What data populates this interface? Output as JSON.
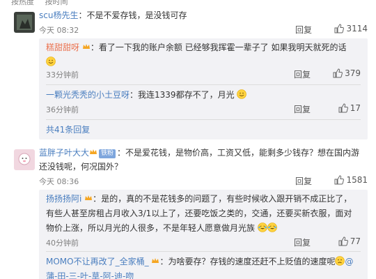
{
  "top_strip": {
    "left": "按热度",
    "right": "按时间"
  },
  "comments": [
    {
      "user": "scu杨先生",
      "text": "不是不爱存钱，是没钱可存",
      "time": "今天 08:32",
      "reply_label": "回复",
      "likes": "3114",
      "replies": [
        {
          "user": "糕甜甜呀",
          "text": "看了一下我的账户余额  已经够我挥霍一辈子了  如果我明天就死的话",
          "time": "33分钟前",
          "reply_label": "回复",
          "likes": "379"
        },
        {
          "user": "一颗光秃秃的小土豆呀",
          "text": "我连1339都存不了，月光",
          "time": "36分钟前",
          "reply_label": "回复",
          "likes": "17"
        }
      ],
      "more_replies": "共41条回复"
    },
    {
      "user": "蓝胖子叶大大",
      "badge": "铁粉",
      "text_line1": "不是爱花钱，是物价高，工资又低，能剩多少钱存？想在国内游",
      "text_line2": "还没钱呢，何况国外？",
      "time": "今天 08:36",
      "reply_label": "回复",
      "likes": "1581",
      "replies": [
        {
          "user": "扬扬扬阿i",
          "line1": "是的，真的不是花钱多的问题了，有些时候收入跟开销不成正比了，",
          "line2": "有些人甚至房租占月收入3/1以上了，还要吃饭之类的，交通，还要买新衣服，面对",
          "line3": "物价上涨，所以月光的人很多，不是年轻人愿意做月光族",
          "time": "40分钟前",
          "reply_label": "回复",
          "likes": "77"
        },
        {
          "user": "MOMO不让再改了_全家桶_",
          "line1": "为啥要存？存钱的速度还赶不上贬值的速度呢",
          "line1_tail": "@",
          "line2": "蒲-田-三-叶-草-阿-迪-吻"
        }
      ]
    }
  ],
  "colors": {
    "username": "#eb7350",
    "link": "#4a7ebf",
    "reply_bg": "#f2f2f5"
  }
}
